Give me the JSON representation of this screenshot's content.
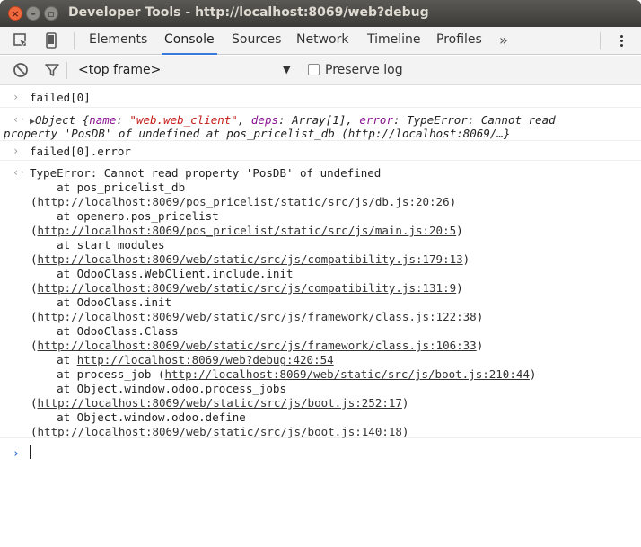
{
  "window": {
    "title": "Developer Tools - http://localhost:8069/web?debug",
    "close_glyph": "×",
    "min_glyph": "–",
    "max_glyph": "▫"
  },
  "tabs": [
    {
      "label": "Elements"
    },
    {
      "label": "Console",
      "active": true
    },
    {
      "label": "Sources"
    },
    {
      "label": "Network"
    },
    {
      "label": "Timeline"
    },
    {
      "label": "Profiles"
    }
  ],
  "overflow_label": "»",
  "toolbar": {
    "frame_select": "<top frame>",
    "preserve_log_label": "Preserve log",
    "preserve_log_checked": false
  },
  "console": {
    "cmd1": "failed[0]",
    "obj_line1_prefix": "Object {",
    "obj_key_name": "name",
    "obj_val_name": "\"web.web_client\"",
    "obj_key_deps": "deps",
    "obj_val_deps": "Array[1]",
    "obj_key_error": "error",
    "obj_error_text": "TypeError: Cannot read",
    "obj_line2": "property 'PosDB' of undefined at pos_pricelist_db (http://localhost:8069/…}",
    "cmd2": "failed[0].error",
    "error_head": "TypeError: Cannot read property 'PosDB' of undefined",
    "stack": [
      {
        "at": "    at pos_pricelist_db",
        "url": "http://localhost:8069/pos_pricelist/static/src/js/db.js:20:26"
      },
      {
        "at": "    at openerp.pos_pricelist",
        "url": "http://localhost:8069/pos_pricelist/static/src/js/main.js:20:5"
      },
      {
        "at": "    at start_modules",
        "url": "http://localhost:8069/web/static/src/js/compatibility.js:179:13"
      },
      {
        "at": "    at OdooClass.WebClient.include.init",
        "url": "http://localhost:8069/web/static/src/js/compatibility.js:131:9"
      },
      {
        "at": "    at OdooClass.init",
        "url": "http://localhost:8069/web/static/src/js/framework/class.js:122:38"
      },
      {
        "at": "    at OdooClass.Class",
        "url": "http://localhost:8069/web/static/src/js/framework/class.js:106:33"
      }
    ],
    "stack_inline1_prefix": "    at ",
    "stack_inline1_url": "http://localhost:8069/web?debug:420:54",
    "stack_inline2_prefix": "    at process_job (",
    "stack_inline2_url": "http://localhost:8069/web/static/src/js/boot.js:210:44",
    "stack_inline2_suffix": ")",
    "stack_tail": [
      {
        "at": "    at Object.window.odoo.process_jobs",
        "url": "http://localhost:8069/web/static/src/js/boot.js:252:17"
      },
      {
        "at": "    at Object.window.odoo.define",
        "url": "http://localhost:8069/web/static/src/js/boot.js:140:18"
      }
    ],
    "input_prompt": "›",
    "output_marker": "‹·",
    "input_marker": "›"
  },
  "colors": {
    "accent": "#3879d9",
    "keyword": "#881391",
    "string": "#c41a16",
    "number": "#1c00cf"
  }
}
